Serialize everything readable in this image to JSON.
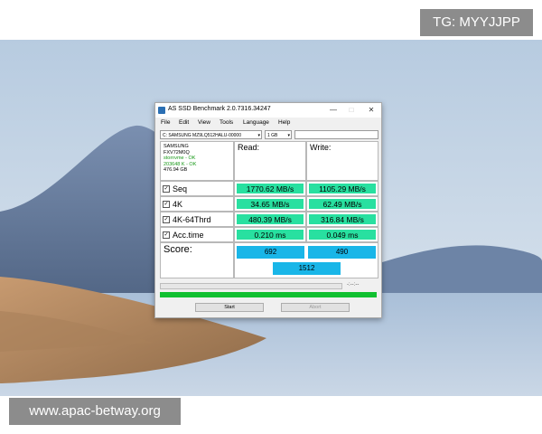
{
  "watermarks": {
    "top": "TG: MYYJJPP",
    "bottom": "www.apac-betway.org"
  },
  "window": {
    "title": "AS SSD Benchmark 2.0.7316.34247",
    "controls": {
      "minimize": "—",
      "maximize": "□",
      "close": "✕"
    }
  },
  "menu": [
    "File",
    "Edit",
    "View",
    "Tools",
    "Language",
    "Help"
  ],
  "drive_select": {
    "value": "C: SAMSUNG MZ9LQ512HALU-00000"
  },
  "size_select": {
    "value": "1 GB"
  },
  "device": {
    "vendor": "SAMSUNG",
    "model": "FXV72M0Q",
    "driver": "stornvme - OK",
    "alignment": "203648 K - OK",
    "capacity": "476.94 GB"
  },
  "columns": {
    "read": "Read:",
    "write": "Write:"
  },
  "tests": [
    {
      "label": "Seq",
      "checked": true,
      "read": "1770.62 MB/s",
      "write": "1105.29 MB/s"
    },
    {
      "label": "4K",
      "checked": true,
      "read": "34.65 MB/s",
      "write": "62.49 MB/s"
    },
    {
      "label": "4K-64Thrd",
      "checked": true,
      "read": "480.39 MB/s",
      "write": "316.84 MB/s"
    },
    {
      "label": "Acc.time",
      "checked": true,
      "read": "0.210 ms",
      "write": "0.049 ms"
    }
  ],
  "score": {
    "label": "Score:",
    "read": "692",
    "write": "490",
    "total": "1512"
  },
  "progress": {
    "time": "-:--:--",
    "fraction": 0
  },
  "buttons": {
    "start": "Start",
    "abort": "Abort"
  },
  "colors": {
    "result_bg": "#28e0a0",
    "score_bg": "#19b6e8",
    "status_green": "#10c030"
  }
}
